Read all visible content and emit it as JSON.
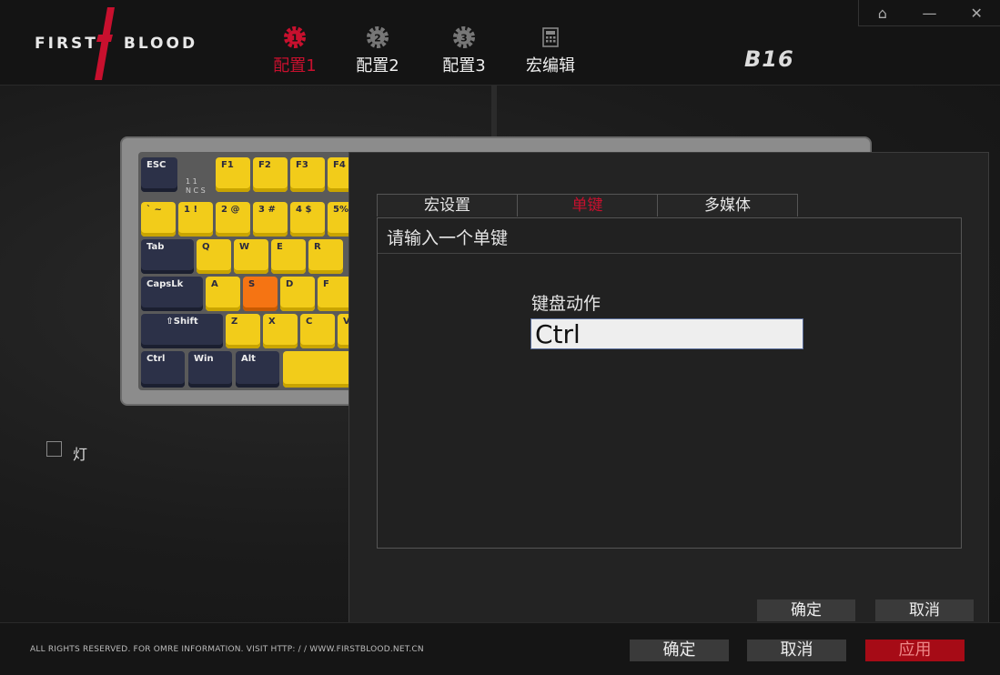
{
  "app": {
    "logo_text": "FIRST",
    "logo_text2": "BLOOD",
    "model": "B16"
  },
  "window_controls": {
    "home_icon": "home-icon",
    "minimize_icon": "minimize-icon",
    "close_icon": "close-icon"
  },
  "tabs": [
    {
      "label": "配置1",
      "icon": "profile-1-gear-icon",
      "active": true
    },
    {
      "label": "配置2",
      "icon": "profile-2-gear-icon",
      "active": false
    },
    {
      "label": "配置3",
      "icon": "profile-3-gear-icon",
      "active": false
    },
    {
      "label": "宏编辑",
      "icon": "calculator-icon",
      "active": false
    }
  ],
  "keyboard": {
    "keys": {
      "esc": "ESC",
      "f1": "F1",
      "f2": "F2",
      "f3": "F3",
      "f4": "F4",
      "tilde": "` ~",
      "k1": "1 !",
      "k2": "2 @",
      "k3": "3 #",
      "k4": "4 $",
      "k5": "5%",
      "tab": "Tab",
      "q": "Q",
      "w": "W",
      "e": "E",
      "r": "R",
      "caps": "CapsLk",
      "a": "A",
      "s": "S",
      "d": "D",
      "f": "F",
      "shift": "⇧Shift",
      "z": "Z",
      "x": "X",
      "c": "C",
      "v": "V",
      "ctrl": "Ctrl",
      "win": "Win",
      "alt": "Alt"
    },
    "selected_key": "S"
  },
  "light_option": {
    "label": "灯",
    "checked": false
  },
  "dialog": {
    "tabs": [
      {
        "label": "宏设置",
        "active": false
      },
      {
        "label": "单键",
        "active": true
      },
      {
        "label": "多媒体",
        "active": false
      }
    ],
    "prompt": "请输入一个单键",
    "field_label": "键盘动作",
    "field_value": "Ctrl",
    "ok_label": "确定",
    "cancel_label": "取消"
  },
  "footer": {
    "copyright": "ALL RIGHTS RESERVED. FOR OMRE INFORMATION. VISIT HTTP: / / WWW.FIRSTBLOOD.NET.CN",
    "ok_label": "确定",
    "cancel_label": "取消",
    "apply_label": "应用"
  },
  "colors": {
    "accent_red": "#c8102e",
    "key_yellow": "#f2cc1a",
    "key_dark": "#2c3148",
    "key_selected": "#f57413"
  }
}
